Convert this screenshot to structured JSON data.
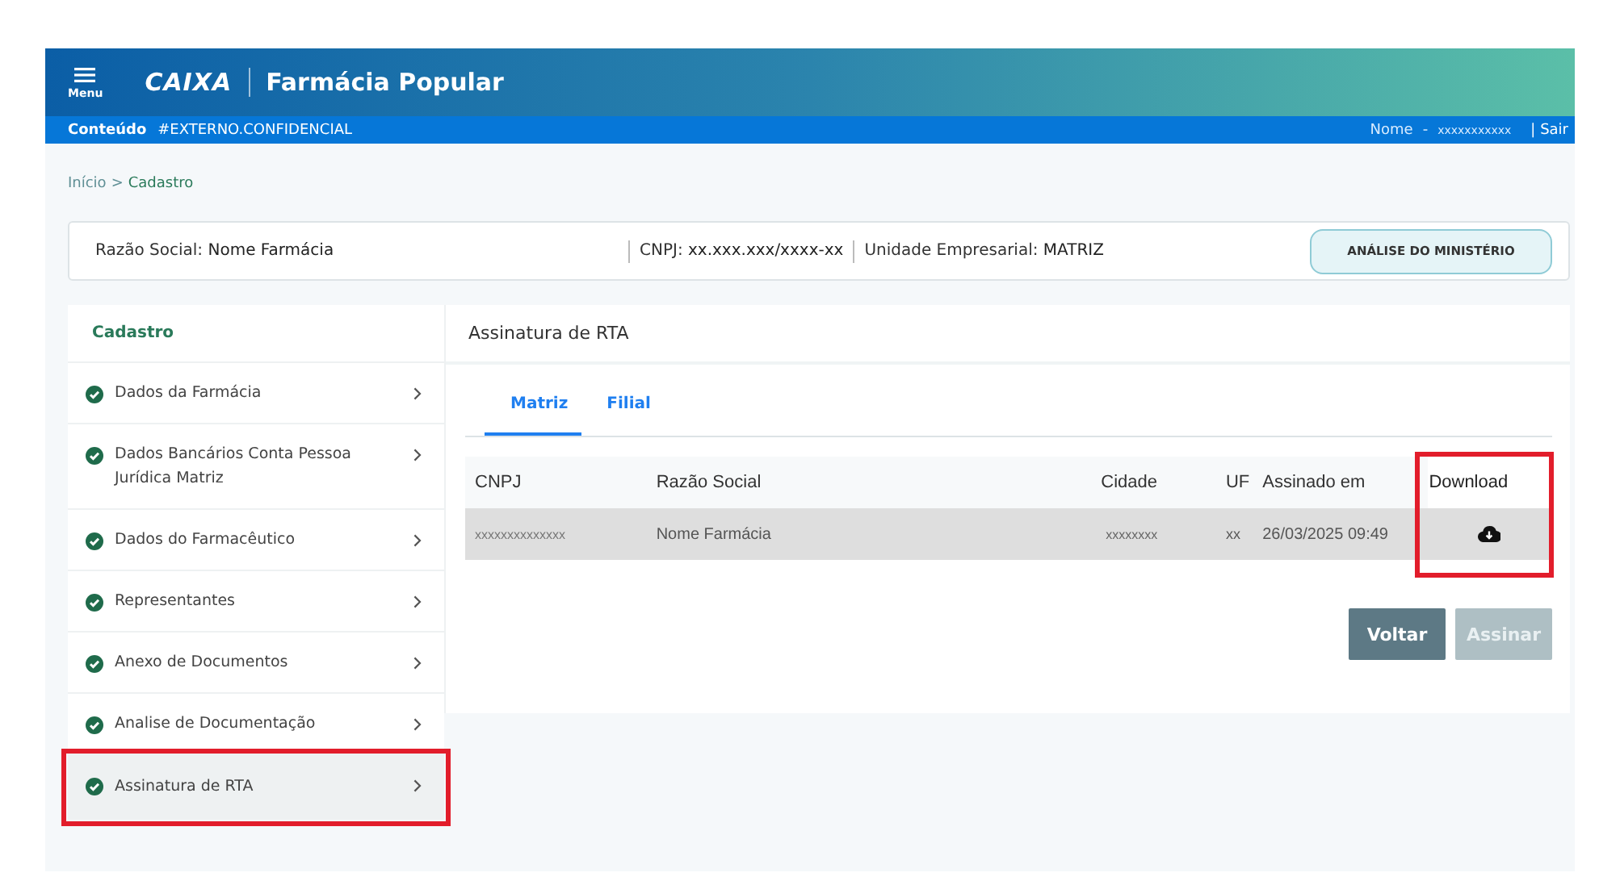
{
  "header": {
    "menu_label": "Menu",
    "brand": "CAIXA",
    "title": "Farmácia Popular"
  },
  "subbar": {
    "label": "Conteúdo",
    "classification": "#EXTERNO.CONFIDENCIAL",
    "user_label": "Nome",
    "user_sep": "-",
    "user_value": "xxxxxxxxxxx",
    "logout": "| Sair"
  },
  "breadcrumb": [
    {
      "text": "Início",
      "current": false
    },
    {
      "text": ">",
      "current": false
    },
    {
      "text": "Cadastro",
      "current": true
    }
  ],
  "info": {
    "fields": [
      {
        "label": "Razão Social:",
        "value": "Nome Farmácia"
      },
      {
        "label": "CNPJ:",
        "value": "xx.xxx.xxx/xxxx-xx"
      },
      {
        "label": "Unidade Empresarial:",
        "value": "MATRIZ"
      }
    ],
    "button": "ANÁLISE DO MINISTÉRIO"
  },
  "sidebar": {
    "title": "Cadastro",
    "items": [
      {
        "label": "Dados da Farmácia",
        "done": true,
        "selected": false,
        "highlighted": false
      },
      {
        "label": "Dados Bancários Conta Pessoa Jurídica Matriz",
        "done": true,
        "selected": false,
        "highlighted": false
      },
      {
        "label": "Dados do Farmacêutico",
        "done": true,
        "selected": false,
        "highlighted": false
      },
      {
        "label": "Representantes",
        "done": true,
        "selected": false,
        "highlighted": false
      },
      {
        "label": "Anexo de Documentos",
        "done": true,
        "selected": false,
        "highlighted": false
      },
      {
        "label": "Analise de Documentação",
        "done": true,
        "selected": false,
        "highlighted": false
      },
      {
        "label": "Assinatura de RTA",
        "done": true,
        "selected": true,
        "highlighted": true
      }
    ]
  },
  "panel": {
    "title": "Assinatura de RTA",
    "tabs": [
      {
        "label": "Matriz",
        "selected": true
      },
      {
        "label": "Filial",
        "selected": false
      }
    ],
    "table": {
      "columns": [
        {
          "label": "CNPJ",
          "highlighted": false
        },
        {
          "label": "Razão Social",
          "highlighted": false
        },
        {
          "label": "Cidade",
          "highlighted": false
        },
        {
          "label": "UF",
          "highlighted": false
        },
        {
          "label": "Assinado em",
          "highlighted": false
        },
        {
          "label": "Download",
          "highlighted": true
        }
      ],
      "rows": [
        {
          "cnpj": "xxxxxxxxxxxxxx",
          "razao_social": "Nome Farmácia",
          "cidade": "xxxxxxxx",
          "uf": "xx",
          "assinado_em": "26/03/2025 09:49"
        }
      ]
    },
    "buttons": [
      {
        "label": "Voltar",
        "disabled": false
      },
      {
        "label": "Assinar",
        "disabled": true
      }
    ]
  }
}
